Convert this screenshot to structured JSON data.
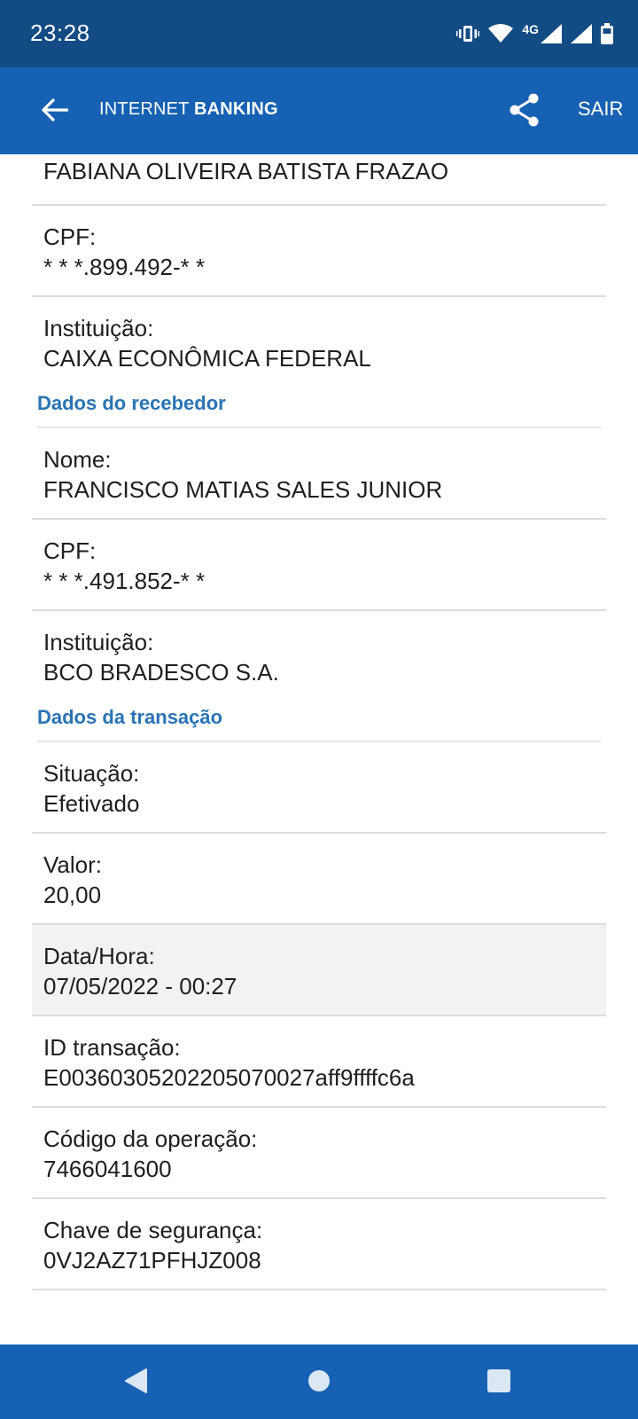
{
  "status_bar": {
    "time": "23:28",
    "network": "4G"
  },
  "header": {
    "title_part1": "INTERNET ",
    "title_part2": "BANKING",
    "exit_label": "SAIR"
  },
  "payer": {
    "name_value": "FABIANA OLIVEIRA BATISTA FRAZAO",
    "cpf_label": "CPF:",
    "cpf_value": "* * *.899.492-* *",
    "institution_label": "Instituição:",
    "institution_value": "CAIXA ECONÔMICA FEDERAL"
  },
  "receiver": {
    "section_title": "Dados do recebedor",
    "name_label": "Nome:",
    "name_value": "FRANCISCO MATIAS SALES JUNIOR",
    "cpf_label": "CPF:",
    "cpf_value": "* * *.491.852-* *",
    "institution_label": "Instituição:",
    "institution_value": "BCO BRADESCO S.A."
  },
  "transaction": {
    "section_title": "Dados da transação",
    "status_label": "Situação:",
    "status_value": "Efetivado",
    "amount_label": "Valor:",
    "amount_value": "20,00",
    "datetime_label": "Data/Hora:",
    "datetime_value": "07/05/2022 - 00:27",
    "id_label": "ID transação:",
    "id_value": "E00360305202205070027aff9ffffc6a",
    "operation_code_label": "Código da operação:",
    "operation_code_value": "7466041600",
    "security_key_label": "Chave de segurança:",
    "security_key_value": "0VJ2AZ71PFHJZ008"
  },
  "colors": {
    "status_bar": "#134b85",
    "app_bar": "#1761b4",
    "section_title": "#2a73b6",
    "highlight_row": "#f3f2f2"
  }
}
